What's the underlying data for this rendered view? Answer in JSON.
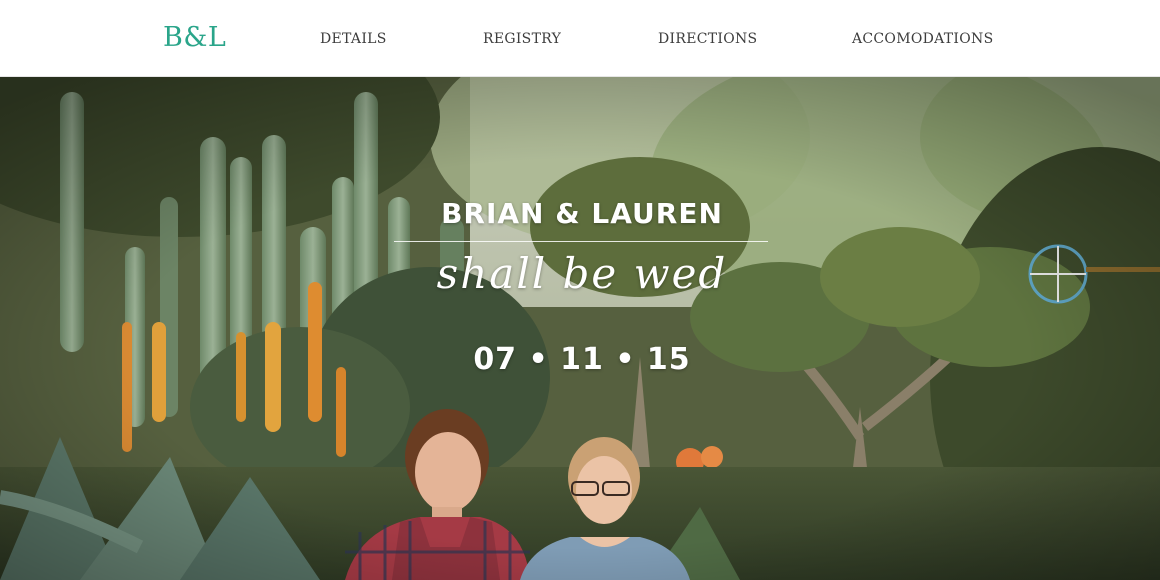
{
  "header": {
    "logo": "B&L",
    "nav": [
      {
        "label": "DETAILS"
      },
      {
        "label": "REGISTRY"
      },
      {
        "label": "DIRECTIONS"
      },
      {
        "label": "ACCOMODATIONS"
      }
    ]
  },
  "hero": {
    "names": "BRIAN & LAUREN",
    "tagline": "shall be wed",
    "date": "07 • 11 • 15"
  },
  "colors": {
    "brand": "#2aa58a",
    "nav_text": "#3d3d3d",
    "hero_text": "#ffffff"
  }
}
